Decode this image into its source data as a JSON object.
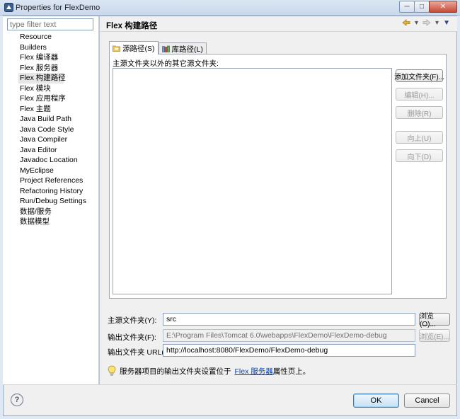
{
  "window": {
    "title": "Properties for FlexDemo",
    "min_label": "─",
    "max_label": "□",
    "close_label": "✕"
  },
  "sidebar": {
    "filter_placeholder": "type filter text",
    "items": [
      {
        "label": "Resource"
      },
      {
        "label": "Builders"
      },
      {
        "label": "Flex 编译器"
      },
      {
        "label": "Flex 服务器"
      },
      {
        "label": "Flex 构建路径",
        "selected": true
      },
      {
        "label": "Flex 模块"
      },
      {
        "label": "Flex 应用程序"
      },
      {
        "label": "Flex 主题"
      },
      {
        "label": "Java Build Path"
      },
      {
        "label": "Java Code Style"
      },
      {
        "label": "Java Compiler"
      },
      {
        "label": "Java Editor"
      },
      {
        "label": "Javadoc Location"
      },
      {
        "label": "MyEclipse"
      },
      {
        "label": "Project References"
      },
      {
        "label": "Refactoring History"
      },
      {
        "label": "Run/Debug Settings"
      },
      {
        "label": "数据/服务"
      },
      {
        "label": "数据模型"
      }
    ]
  },
  "page": {
    "title": "Flex 构建路径",
    "tabs": [
      {
        "label": "源路径(S)",
        "active": true,
        "icon": "source-folder-icon"
      },
      {
        "label": "库路径(L)",
        "active": false,
        "icon": "library-icon"
      }
    ],
    "list_label": "主源文件夹以外的其它源文件夹:",
    "side_buttons": [
      {
        "label": "添加文件夹(F)...",
        "enabled": true
      },
      {
        "label": "编辑(H)...",
        "enabled": false
      },
      {
        "label": "删除(R)",
        "enabled": false
      },
      {
        "label": "向上(U)",
        "enabled": false
      },
      {
        "label": "向下(D)",
        "enabled": false
      }
    ],
    "main_source_label": "主源文件夹(Y):",
    "main_source_value": "src",
    "output_folder_label": "输出文件夹(F):",
    "output_folder_value": "E:\\Program Files\\Tomcat 6.0\\webapps\\FlexDemo\\FlexDemo-debug",
    "output_url_label": "输出文件夹 URL(I):",
    "output_url_value": "http://localhost:8080/FlexDemo/FlexDemo-debug",
    "browse_label_1": "浏览(O)...",
    "browse_label_2": "浏览(E)...",
    "hint_prefix": "服务器项目的输出文件夹设置位于",
    "hint_link": "Flex 服务器",
    "hint_suffix": "属性页上。"
  },
  "buttons": {
    "help": "?",
    "ok": "OK",
    "cancel": "Cancel"
  },
  "colors": {
    "selection": "#e6e6e6",
    "link": "#0645ad",
    "ok_border": "#3c7fb1"
  }
}
